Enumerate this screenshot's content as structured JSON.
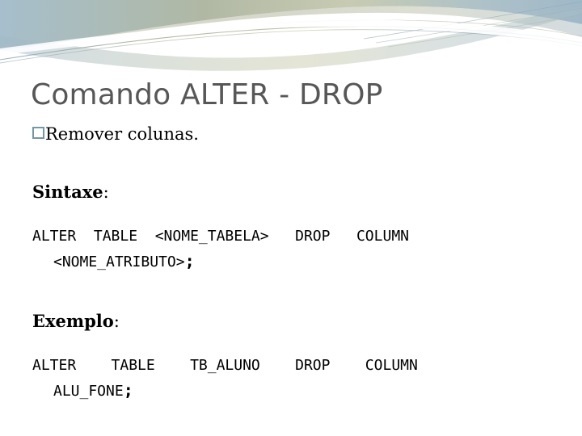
{
  "slide": {
    "title": "Comando ALTER - DROP",
    "theme": {
      "title_color": "#575757",
      "bullet_color": "#7397a8",
      "band_blue": "#a9c2cf",
      "band_khaki": "#b5b9a0",
      "band_sage": "#c3c9b3",
      "background": "#ffffff"
    },
    "bullets": [
      {
        "glyph": "hollow-square-bullet",
        "text": "Remover colunas."
      }
    ],
    "sections": [
      {
        "label": "Sintaxe",
        "colon": ":",
        "code_line_1": "ALTER  TABLE  <NOME_TABELA>   DROP   COLUMN",
        "code_line_2": "<NOME_ATRIBUTO>",
        "terminator": ";"
      },
      {
        "label": "Exemplo",
        "colon": ":",
        "code_line_1": "ALTER    TABLE    TB_ALUNO    DROP    COLUMN",
        "code_line_2": "ALU_FONE",
        "terminator": ";"
      }
    ]
  }
}
